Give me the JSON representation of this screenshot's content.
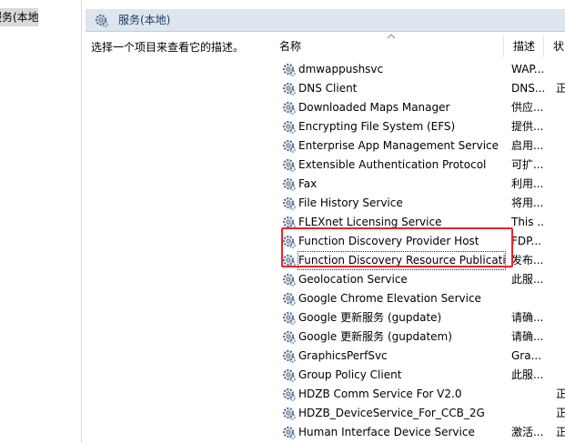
{
  "tree": {
    "selected_label": "服务(本地)"
  },
  "panel": {
    "title": "服务(本地)",
    "description_hint": "选择一个项目来查看它的描述。"
  },
  "columns": {
    "name": "名称",
    "desc": "描述",
    "status": "状"
  },
  "services": [
    {
      "name": "dmwappushsvc",
      "desc": "WAP...",
      "status": ""
    },
    {
      "name": "DNS Client",
      "desc": "DNS...",
      "status": "正"
    },
    {
      "name": "Downloaded Maps Manager",
      "desc": "供应...",
      "status": ""
    },
    {
      "name": "Encrypting File System (EFS)",
      "desc": "提供...",
      "status": ""
    },
    {
      "name": "Enterprise App Management Service",
      "desc": "启用...",
      "status": ""
    },
    {
      "name": "Extensible Authentication Protocol",
      "desc": "可扩...",
      "status": ""
    },
    {
      "name": "Fax",
      "desc": "利用...",
      "status": ""
    },
    {
      "name": "File History Service",
      "desc": "将用...",
      "status": ""
    },
    {
      "name": "FLEXnet Licensing Service",
      "desc": "This ...",
      "status": ""
    },
    {
      "name": "Function Discovery Provider Host",
      "desc": "FDP...",
      "status": ""
    },
    {
      "name": "Function Discovery Resource Publicati...",
      "desc": "发布...",
      "status": ""
    },
    {
      "name": "Geolocation Service",
      "desc": "此服...",
      "status": ""
    },
    {
      "name": "Google Chrome Elevation Service",
      "desc": "",
      "status": ""
    },
    {
      "name": "Google 更新服务 (gupdate)",
      "desc": "请确...",
      "status": ""
    },
    {
      "name": "Google 更新服务 (gupdatem)",
      "desc": "请确...",
      "status": ""
    },
    {
      "name": "GraphicsPerfSvc",
      "desc": "Gra...",
      "status": ""
    },
    {
      "name": "Group Policy Client",
      "desc": "此服...",
      "status": ""
    },
    {
      "name": "HDZB Comm Service For V2.0",
      "desc": "",
      "status": "正"
    },
    {
      "name": "HDZB_DeviceService_For_CCB_2G",
      "desc": "",
      "status": "正"
    },
    {
      "name": "Human Interface Device Service",
      "desc": "激活...",
      "status": "正"
    }
  ],
  "icons": {
    "service": "gear-service-icon",
    "header": "gear-service-icon",
    "sort": "sort-up-icon"
  },
  "colors": {
    "highlight_box": "#e8262a",
    "header_bg": "#dde5ef"
  }
}
